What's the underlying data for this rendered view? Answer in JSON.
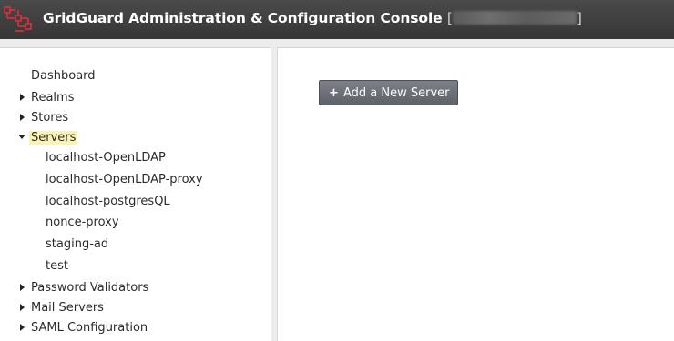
{
  "header": {
    "title": "GridGuard Administration & Configuration Console",
    "bracket_open": "[",
    "bracket_close": "]",
    "logo_icon": "grid-network-logo-icon"
  },
  "sidebar": {
    "items": [
      {
        "label": "Dashboard",
        "icon": "none"
      },
      {
        "label": "Realms",
        "icon": "caret-right-icon"
      },
      {
        "label": "Stores",
        "icon": "caret-right-icon"
      },
      {
        "label": "Servers",
        "icon": "caret-down-icon",
        "selected": true
      },
      {
        "label": "Password Validators",
        "icon": "caret-right-icon"
      },
      {
        "label": "Mail Servers",
        "icon": "caret-right-icon"
      },
      {
        "label": "SAML Configuration",
        "icon": "caret-right-icon"
      }
    ],
    "servers": [
      "localhost-OpenLDAP",
      "localhost-OpenLDAP-proxy",
      "localhost-postgresQL",
      "nonce-proxy",
      "staging-ad",
      "test"
    ]
  },
  "main": {
    "add_button_label": "Add a New Server",
    "add_button_icon": "plus-icon"
  },
  "colors": {
    "header_bg": "#3d3d3d",
    "logo_red": "#e0303a",
    "selected_highlight": "#fbf3b5",
    "button_bg": "#6b6f76"
  }
}
